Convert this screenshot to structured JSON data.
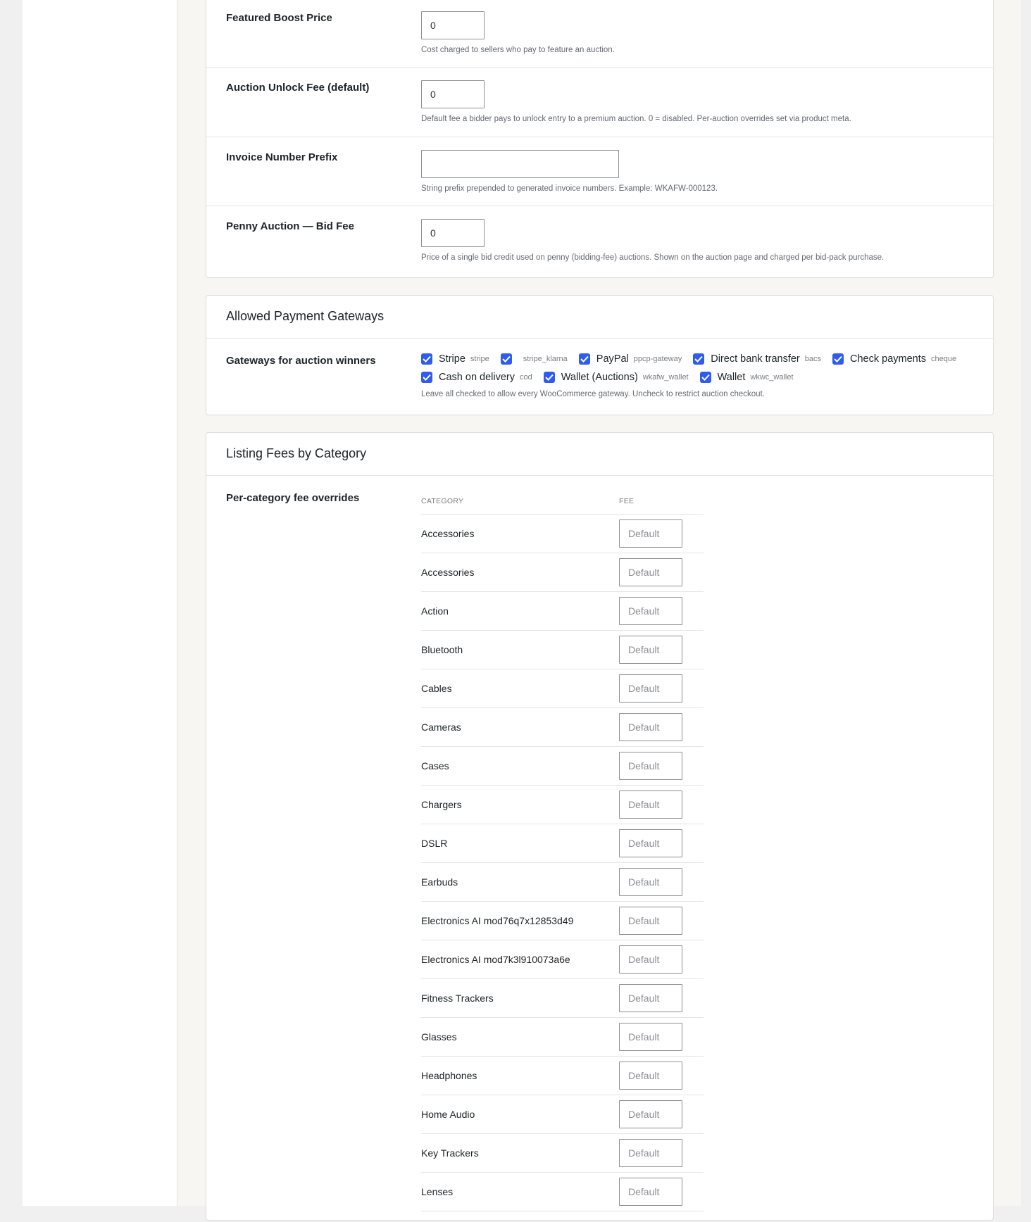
{
  "settings": {
    "featured_boost": {
      "label": "Featured Boost Price",
      "value": "0",
      "help": "Cost charged to sellers who pay to feature an auction."
    },
    "unlock_fee": {
      "label": "Auction Unlock Fee (default)",
      "value": "0",
      "help": "Default fee a bidder pays to unlock entry to a premium auction. 0 = disabled. Per-auction overrides set via product meta."
    },
    "invoice_prefix": {
      "label": "Invoice Number Prefix",
      "value": "",
      "help": "String prefix prepended to generated invoice numbers. Example: WKAFW-000123."
    },
    "penny_bid_fee": {
      "label": "Penny Auction — Bid Fee",
      "value": "0",
      "help": "Price of a single bid credit used on penny (bidding-fee) auctions. Shown on the auction page and charged per bid-pack purchase."
    }
  },
  "gateways": {
    "title": "Allowed Payment Gateways",
    "label": "Gateways for auction winners",
    "items": [
      {
        "name": "Stripe",
        "id": "stripe",
        "checked": true
      },
      {
        "name": "",
        "id": "stripe_klarna",
        "checked": true
      },
      {
        "name": "PayPal",
        "id": "ppcp-gateway",
        "checked": true
      },
      {
        "name": "Direct bank transfer",
        "id": "bacs",
        "checked": true
      },
      {
        "name": "Check payments",
        "id": "cheque",
        "checked": true
      },
      {
        "name": "Cash on delivery",
        "id": "cod",
        "checked": true
      },
      {
        "name": "Wallet (Auctions)",
        "id": "wkafw_wallet",
        "checked": true
      },
      {
        "name": "Wallet",
        "id": "wkwc_wallet",
        "checked": true
      }
    ],
    "help": "Leave all checked to allow every WooCommerce gateway. Uncheck to restrict auction checkout."
  },
  "listing_fees": {
    "title": "Listing Fees by Category",
    "label": "Per-category fee overrides",
    "col_category": "CATEGORY",
    "col_fee": "FEE",
    "placeholder": "Default",
    "categories": [
      "Accessories",
      "Accessories",
      "Action",
      "Bluetooth",
      "Cables",
      "Cameras",
      "Cases",
      "Chargers",
      "DSLR",
      "Earbuds",
      "Electronics AI mod76q7x12853d49",
      "Electronics AI mod7k3l910073a6e",
      "Fitness Trackers",
      "Glasses",
      "Headphones",
      "Home Audio",
      "Key Trackers",
      "Lenses"
    ]
  },
  "colors": {
    "checkbox": "#2e5cf1",
    "page_bg": "#f8f6f2",
    "card_border": "#dcdcde"
  }
}
